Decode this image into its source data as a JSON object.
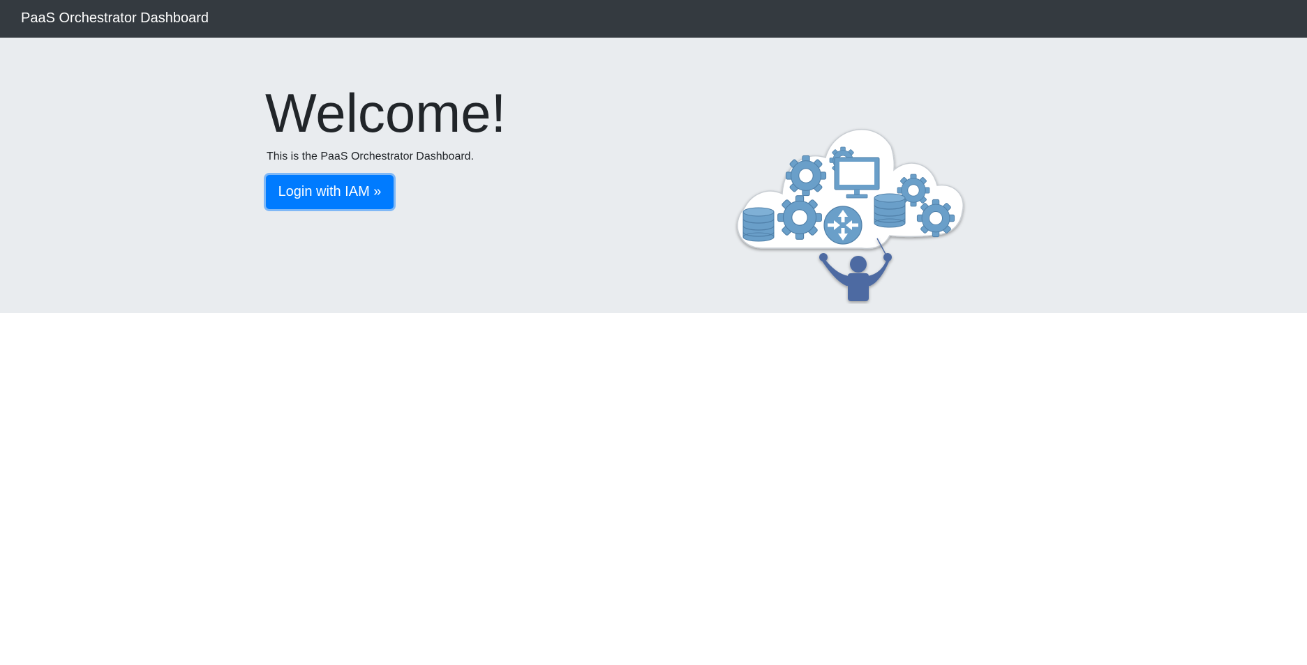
{
  "navbar": {
    "brand": "PaaS Orchestrator Dashboard"
  },
  "hero": {
    "title": "Welcome!",
    "lead": "This is the PaaS Orchestrator Dashboard.",
    "login_button": "Login with IAM »",
    "illustration": {
      "icons": [
        "cloud-icon",
        "gear-icon",
        "monitor-icon",
        "database-icon",
        "router-icon",
        "person-icon"
      ]
    }
  },
  "colors": {
    "navbar_bg": "#343a40",
    "hero_bg": "#e9ecef",
    "button_primary": "#007bff",
    "illustration_blue": "#6a9fc9",
    "person_blue": "#4d6aa2"
  }
}
